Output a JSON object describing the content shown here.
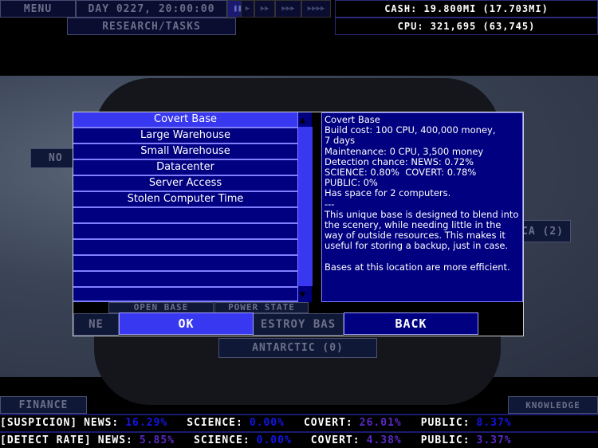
{
  "topbar": {
    "menu": "MENU",
    "day": "DAY 0227, 20:00:00",
    "speeds": [
      "❚❚",
      "▶",
      "▶▶",
      "▶▶▶",
      "▶▶▶▶"
    ],
    "research": "RESEARCH/TASKS",
    "cash": "CASH: 19.800mi (17.703mi)",
    "cpu": "CPU: 321,695 (63,745)"
  },
  "background": {
    "north": "NO",
    "continent": "CA (2)",
    "antarctic": "ANTARCTIC (0)",
    "new_base": "NE",
    "destroy_base": "ESTROY BAS",
    "open_base": "OPEN BASE",
    "power_state": "POWER STATE"
  },
  "dialog": {
    "items": [
      "Covert Base",
      "Large Warehouse",
      "Small Warehouse",
      "Datacenter",
      "Server Access",
      "Stolen Computer Time",
      "",
      "",
      "",
      "",
      "",
      ""
    ],
    "selected_index": 0,
    "description": "Covert Base\nBuild cost: 100 CPU, 400,000 money,\n7 days\nMaintenance: 0 CPU, 3,500 money\nDetection chance: NEWS: 0.72%\nSCIENCE: 0.80%  COVERT: 0.78%\nPUBLIC: 0%\nHas space for 2 computers.\n---\nThis unique base is designed to blend into the scenery, while needing little in the way of outside resources. This makes it useful for storing a backup, just in case.\n\nBases at this location are more efficient.",
    "ok": "OK",
    "back": "BACK"
  },
  "bottom": {
    "finance": "FINANCE",
    "knowledge": "KNOWLEDGE",
    "suspicion": {
      "label": "[SUSPICION]",
      "news": "16.29%",
      "science": "0.00%",
      "covert": "26.01%",
      "public": "8.37%"
    },
    "detect": {
      "label": "[DETECT RATE]",
      "news": "5.85%",
      "science": "0.00%",
      "covert": "4.38%",
      "public": "3.37%"
    },
    "labels": {
      "news": "NEWS:",
      "science": "SCIENCE:",
      "covert": "COVERT:",
      "public": "PUBLIC:"
    }
  },
  "colors": {
    "blue": "#1414e8",
    "purple": "#5a28c8",
    "accent": "#3838f0",
    "panel": "#000080"
  }
}
